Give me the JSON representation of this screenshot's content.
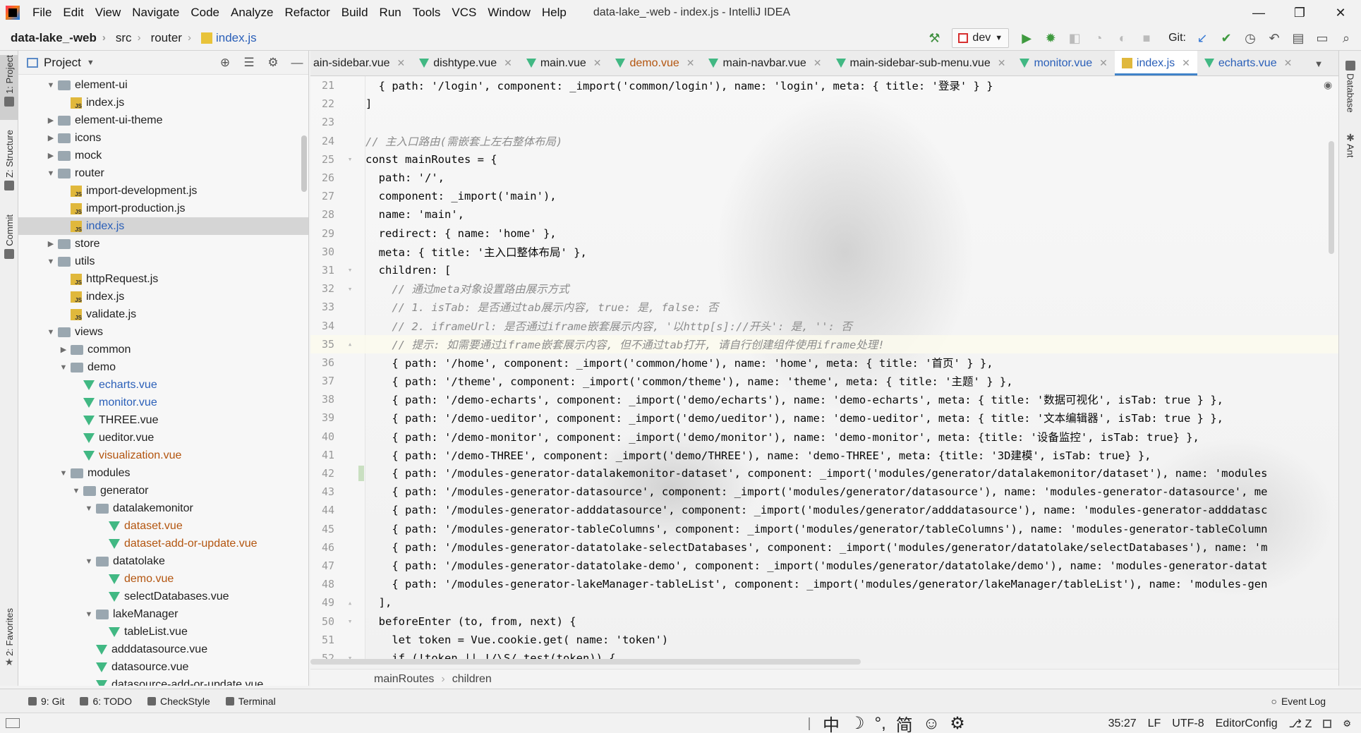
{
  "menubar": {
    "items": [
      "File",
      "Edit",
      "View",
      "Navigate",
      "Code",
      "Analyze",
      "Refactor",
      "Build",
      "Run",
      "Tools",
      "VCS",
      "Window",
      "Help"
    ],
    "title": "data-lake_-web - index.js - IntelliJ IDEA",
    "controls": {
      "minimize": "—",
      "restore": "❐",
      "close": "✕"
    }
  },
  "navbar": {
    "crumbs": [
      "data-lake_-web",
      "src",
      "router",
      "index.js"
    ],
    "run_config": "dev",
    "git_label": "Git:"
  },
  "left_stripe": {
    "project": "1: Project",
    "structure": "Z: Structure",
    "commit": "Commit",
    "favorites": "2: Favorites"
  },
  "right_stripe": {
    "database": "Database",
    "ant": "Ant"
  },
  "project_panel": {
    "title": "Project",
    "tree": [
      {
        "label": "element-ui",
        "type": "folder",
        "depth": 2,
        "open": true
      },
      {
        "label": "index.js",
        "type": "js",
        "depth": 3
      },
      {
        "label": "element-ui-theme",
        "type": "folder",
        "depth": 2,
        "open": false
      },
      {
        "label": "icons",
        "type": "folder",
        "depth": 2,
        "open": false
      },
      {
        "label": "mock",
        "type": "folder",
        "depth": 2,
        "open": false
      },
      {
        "label": "router",
        "type": "folder",
        "depth": 2,
        "open": true
      },
      {
        "label": "import-development.js",
        "type": "js",
        "depth": 3
      },
      {
        "label": "import-production.js",
        "type": "js",
        "depth": 3
      },
      {
        "label": "index.js",
        "type": "js",
        "depth": 3,
        "selected": true,
        "color": "blue"
      },
      {
        "label": "store",
        "type": "folder",
        "depth": 2,
        "open": false
      },
      {
        "label": "utils",
        "type": "folder",
        "depth": 2,
        "open": true
      },
      {
        "label": "httpRequest.js",
        "type": "js",
        "depth": 3
      },
      {
        "label": "index.js",
        "type": "js",
        "depth": 3
      },
      {
        "label": "validate.js",
        "type": "js",
        "depth": 3
      },
      {
        "label": "views",
        "type": "folder",
        "depth": 2,
        "open": true
      },
      {
        "label": "common",
        "type": "folder",
        "depth": 3,
        "open": false
      },
      {
        "label": "demo",
        "type": "folder",
        "depth": 3,
        "open": true
      },
      {
        "label": "echarts.vue",
        "type": "vue",
        "depth": 4,
        "color": "blue"
      },
      {
        "label": "monitor.vue",
        "type": "vue",
        "depth": 4,
        "color": "blue"
      },
      {
        "label": "THREE.vue",
        "type": "vue",
        "depth": 4
      },
      {
        "label": "ueditor.vue",
        "type": "vue",
        "depth": 4
      },
      {
        "label": "visualization.vue",
        "type": "vue",
        "depth": 4,
        "color": "orange"
      },
      {
        "label": "modules",
        "type": "folder",
        "depth": 3,
        "open": true
      },
      {
        "label": "generator",
        "type": "folder",
        "depth": 4,
        "open": true
      },
      {
        "label": "datalakemonitor",
        "type": "folder",
        "depth": 5,
        "open": true
      },
      {
        "label": "dataset.vue",
        "type": "vue",
        "depth": 6,
        "color": "orange"
      },
      {
        "label": "dataset-add-or-update.vue",
        "type": "vue",
        "depth": 6,
        "color": "orange"
      },
      {
        "label": "datatolake",
        "type": "folder",
        "depth": 5,
        "open": true
      },
      {
        "label": "demo.vue",
        "type": "vue",
        "depth": 6,
        "color": "orange"
      },
      {
        "label": "selectDatabases.vue",
        "type": "vue",
        "depth": 6
      },
      {
        "label": "lakeManager",
        "type": "folder",
        "depth": 5,
        "open": true
      },
      {
        "label": "tableList.vue",
        "type": "vue",
        "depth": 6
      },
      {
        "label": "adddatasource.vue",
        "type": "vue",
        "depth": 5
      },
      {
        "label": "datasource.vue",
        "type": "vue",
        "depth": 5
      },
      {
        "label": "datasource-add-or-update.vue",
        "type": "vue",
        "depth": 5
      }
    ]
  },
  "tabs": [
    {
      "label": "ain-sidebar.vue",
      "type": "vue"
    },
    {
      "label": "dishtype.vue",
      "type": "vue"
    },
    {
      "label": "main.vue",
      "type": "vue"
    },
    {
      "label": "demo.vue",
      "type": "vue",
      "color": "orange"
    },
    {
      "label": "main-navbar.vue",
      "type": "vue"
    },
    {
      "label": "main-sidebar-sub-menu.vue",
      "type": "vue"
    },
    {
      "label": "monitor.vue",
      "type": "vue",
      "color": "blue"
    },
    {
      "label": "index.js",
      "type": "js",
      "color": "blue",
      "active": true
    },
    {
      "label": "echarts.vue",
      "type": "vue",
      "color": "blue"
    }
  ],
  "code": [
    {
      "n": "21",
      "text": "  { path: '/login', component: _import('common/login'), name: 'login', meta: { title: '登录' } }"
    },
    {
      "n": "22",
      "text": "]"
    },
    {
      "n": "23",
      "text": ""
    },
    {
      "n": "24",
      "text": "// 主入口路由(需嵌套上左右整体布局)",
      "comment": true
    },
    {
      "n": "25",
      "text": "const mainRoutes = {"
    },
    {
      "n": "26",
      "text": "  path: '/',"
    },
    {
      "n": "27",
      "text": "  component: _import('main'),"
    },
    {
      "n": "28",
      "text": "  name: 'main',"
    },
    {
      "n": "29",
      "text": "  redirect: { name: 'home' },"
    },
    {
      "n": "30",
      "text": "  meta: { title: '主入口整体布局' },"
    },
    {
      "n": "31",
      "text": "  children: ["
    },
    {
      "n": "32",
      "text": "    // 通过meta对象设置路由展示方式",
      "comment": true
    },
    {
      "n": "33",
      "text": "    // 1. isTab: 是否通过tab展示内容, true: 是, false: 否",
      "comment": true
    },
    {
      "n": "34",
      "text": "    // 2. iframeUrl: 是否通过iframe嵌套展示内容, '以http[s]://开头': 是, '': 否",
      "comment": true
    },
    {
      "n": "35",
      "text": "    // 提示: 如需要通过iframe嵌套展示内容, 但不通过tab打开, 请自行创建组件使用iframe处理!",
      "comment": true,
      "current": true
    },
    {
      "n": "36",
      "text": "    { path: '/home', component: _import('common/home'), name: 'home', meta: { title: '首页' } },"
    },
    {
      "n": "37",
      "text": "    { path: '/theme', component: _import('common/theme'), name: 'theme', meta: { title: '主题' } },"
    },
    {
      "n": "38",
      "text": "    { path: '/demo-echarts', component: _import('demo/echarts'), name: 'demo-echarts', meta: { title: '数据可视化', isTab: true } },"
    },
    {
      "n": "39",
      "text": "    { path: '/demo-ueditor', component: _import('demo/ueditor'), name: 'demo-ueditor', meta: { title: '文本编辑器', isTab: true } },"
    },
    {
      "n": "40",
      "text": "    { path: '/demo-monitor', component: _import('demo/monitor'), name: 'demo-monitor', meta: {title: '设备监控', isTab: true} },"
    },
    {
      "n": "41",
      "text": "    { path: '/demo-THREE', component: _import('demo/THREE'), name: 'demo-THREE', meta: {title: '3D建模', isTab: true} },"
    },
    {
      "n": "42",
      "text": "    { path: '/modules-generator-datalakemonitor-dataset', component: _import('modules/generator/datalakemonitor/dataset'), name: 'modules",
      "changed": true
    },
    {
      "n": "43",
      "text": "    { path: '/modules-generator-datasource', component: _import('modules/generator/datasource'), name: 'modules-generator-datasource', me"
    },
    {
      "n": "44",
      "text": "    { path: '/modules-generator-adddatasource', component: _import('modules/generator/adddatasource'), name: 'modules-generator-adddatasc"
    },
    {
      "n": "45",
      "text": "    { path: '/modules-generator-tableColumns', component: _import('modules/generator/tableColumns'), name: 'modules-generator-tableColumn"
    },
    {
      "n": "46",
      "text": "    { path: '/modules-generator-datatolake-selectDatabases', component: _import('modules/generator/datatolake/selectDatabases'), name: 'm"
    },
    {
      "n": "47",
      "text": "    { path: '/modules-generator-datatolake-demo', component: _import('modules/generator/datatolake/demo'), name: 'modules-generator-datat"
    },
    {
      "n": "48",
      "text": "    { path: '/modules-generator-lakeManager-tableList', component: _import('modules/generator/lakeManager/tableList'), name: 'modules-gen"
    },
    {
      "n": "49",
      "text": "  ],"
    },
    {
      "n": "50",
      "text": "  beforeEnter (to, from, next) {"
    },
    {
      "n": "51",
      "text": "    let token = Vue.cookie.get( name: 'token')"
    },
    {
      "n": "52",
      "text": "    if (!token || !/\\S/.test(token)) {"
    }
  ],
  "code_breadcrumb": [
    "mainRoutes",
    "children"
  ],
  "bottom_tools": [
    "9: Git",
    "6: TODO",
    "CheckStyle",
    "Terminal"
  ],
  "event_log": "Event Log",
  "ime": [
    "中",
    "☽",
    "°,",
    "简",
    "☺",
    "⚙"
  ],
  "statusbar": {
    "position": "35:27",
    "line_sep": "LF",
    "encoding": "UTF-8",
    "config": "EditorConfig",
    "branch": "Z"
  }
}
